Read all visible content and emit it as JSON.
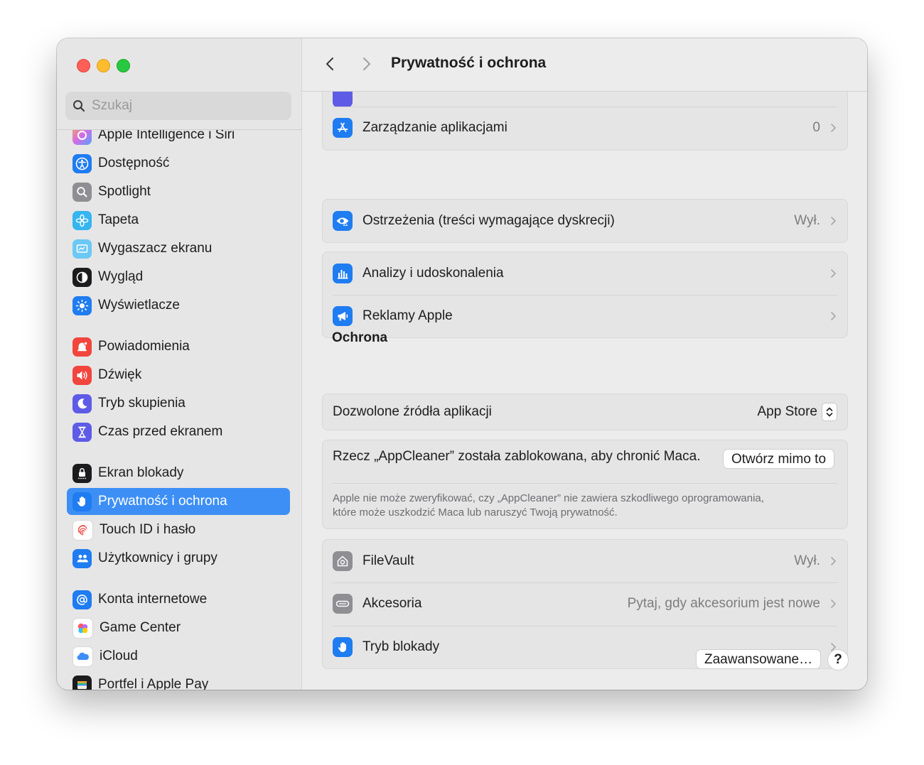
{
  "window": {
    "title": "Prywatność i ochrona"
  },
  "search": {
    "placeholder": "Szukaj"
  },
  "sidebar": {
    "items": [
      {
        "label": "Apple Intelligence i Siri",
        "icon": "apple-intelligence-icon",
        "color": "#b58bf0"
      },
      {
        "label": "Dostępność",
        "icon": "accessibility-icon",
        "color": "#1f7cf1"
      },
      {
        "label": "Spotlight",
        "icon": "magnifier-icon",
        "color": "#8e8e93"
      },
      {
        "label": "Tapeta",
        "icon": "flower-icon",
        "color": "#36b5f0"
      },
      {
        "label": "Wygaszacz ekranu",
        "icon": "screensaver-icon",
        "color": "#5ac8fa"
      },
      {
        "label": "Wygląd",
        "icon": "appearance-icon",
        "color": "#1c1c1e"
      },
      {
        "label": "Wyświetlacze",
        "icon": "sun-icon",
        "color": "#1f7cf1"
      },
      {
        "label": "Powiadomienia",
        "icon": "bell-icon",
        "color": "#f2453d"
      },
      {
        "label": "Dźwięk",
        "icon": "speaker-icon",
        "color": "#f2453d"
      },
      {
        "label": "Tryb skupienia",
        "icon": "moon-icon",
        "color": "#5e5ce6"
      },
      {
        "label": "Czas przed ekranem",
        "icon": "hourglass-icon",
        "color": "#5e5ce6"
      },
      {
        "label": "Ekran blokady",
        "icon": "lock-screen-icon",
        "color": "#1c1c1e"
      },
      {
        "label": "Prywatność i ochrona",
        "icon": "hand-icon",
        "color": "#1f7cf1"
      },
      {
        "label": "Touch ID i hasło",
        "icon": "fingerprint-icon",
        "color": "#ffffff"
      },
      {
        "label": "Użytkownicy i grupy",
        "icon": "users-icon",
        "color": "#1f7cf1"
      },
      {
        "label": "Konta internetowe",
        "icon": "at-icon",
        "color": "#1f7cf1"
      },
      {
        "label": "Game Center",
        "icon": "game-center-icon",
        "color": "#ffffff"
      },
      {
        "label": "iCloud",
        "icon": "cloud-icon",
        "color": "#ffffff"
      },
      {
        "label": "Portfel i Apple Pay",
        "icon": "wallet-icon",
        "color": "#1c1c1e"
      }
    ]
  },
  "main": {
    "rows_top": [
      {
        "label": "Zarządzanie aplikacjami",
        "value": "0",
        "icon": "app-store-icon",
        "color": "#1f7cf1"
      },
      {
        "label": "Ostrzeżenia (treści wymagające dyskrecji)",
        "value": "Wył.",
        "icon": "eye-warning-icon",
        "color": "#1f7cf1"
      },
      {
        "label": "Analizy i udoskonalenia",
        "value": "",
        "icon": "chart-bars-icon",
        "color": "#1f7cf1"
      },
      {
        "label": "Reklamy Apple",
        "value": "",
        "icon": "megaphone-icon",
        "color": "#1f7cf1"
      }
    ],
    "security": {
      "section_title": "Ochrona",
      "allowed_sources_label": "Dozwolone źródła aplikacji",
      "allowed_sources_value": "App Store",
      "blocked_message": "Rzecz „AppCleaner” została zablokowana, aby chronić Maca.",
      "open_anyway": "Otwórz mimo to",
      "blocked_note_line1": "Apple nie może zweryfikować, czy „AppCleaner” nie zawiera szkodliwego oprogramowania,",
      "blocked_note_line2": "które może uszkodzić Maca lub naruszyć Twoją prywatność.",
      "rows": [
        {
          "label": "FileVault",
          "value": "Wył.",
          "icon": "house-safe-icon",
          "color": "#8e8e93"
        },
        {
          "label": "Akcesoria",
          "value": "Pytaj, gdy akcesorium jest nowe",
          "icon": "accessory-icon",
          "color": "#8e8e93"
        },
        {
          "label": "Tryb blokady",
          "value": "",
          "icon": "hand-icon",
          "color": "#1f7cf1"
        }
      ]
    },
    "advanced_button": "Zaawansowane…",
    "help_button": "?"
  }
}
